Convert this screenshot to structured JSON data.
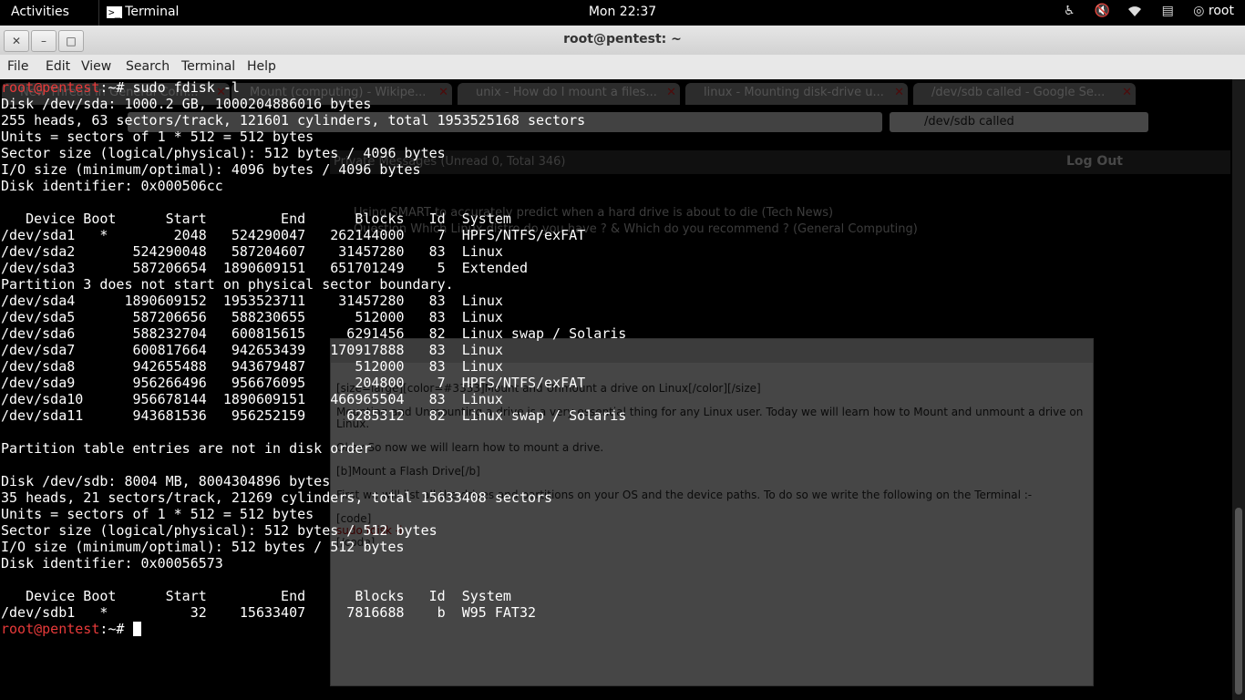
{
  "topbar": {
    "activities": "Activities",
    "app_name": "Terminal",
    "clock": "Mon 22:37",
    "user": "root"
  },
  "window": {
    "title": "root@pentest: ~"
  },
  "menu": [
    "File",
    "Edit",
    "View",
    "Search",
    "Terminal",
    "Help"
  ],
  "terminal": {
    "prompt_user": "root@pentest",
    "prompt_suffix": ":~# ",
    "command": "sudo fdisk -l",
    "output": "Disk /dev/sda: 1000.2 GB, 1000204886016 bytes\n255 heads, 63 sectors/track, 121601 cylinders, total 1953525168 sectors\nUnits = sectors of 1 * 512 = 512 bytes\nSector size (logical/physical): 512 bytes / 4096 bytes\nI/O size (minimum/optimal): 4096 bytes / 4096 bytes\nDisk identifier: 0x000506cc\n\n   Device Boot      Start         End      Blocks   Id  System\n/dev/sda1   *        2048   524290047   262144000    7  HPFS/NTFS/exFAT\n/dev/sda2       524290048   587204607    31457280   83  Linux\n/dev/sda3       587206654  1890609151   651701249    5  Extended\nPartition 3 does not start on physical sector boundary.\n/dev/sda4      1890609152  1953523711    31457280   83  Linux\n/dev/sda5       587206656   588230655      512000   83  Linux\n/dev/sda6       588232704   600815615     6291456   82  Linux swap / Solaris\n/dev/sda7       600817664   942653439   170917888   83  Linux\n/dev/sda8       942655488   943679487      512000   83  Linux\n/dev/sda9       956266496   956676095      204800    7  HPFS/NTFS/exFAT\n/dev/sda10      956678144  1890609151   466965504   83  Linux\n/dev/sda11      943681536   956252159     6285312   82  Linux swap / Solaris\n\nPartition table entries are not in disk order\n\nDisk /dev/sdb: 8004 MB, 8004304896 bytes\n35 heads, 21 sectors/track, 21269 cylinders, total 15633408 sectors\nUnits = sectors of 1 * 512 = 512 bytes\nSector size (logical/physical): 512 bytes / 512 bytes\nI/O size (minimum/optimal): 512 bytes / 512 bytes\nDisk identifier: 0x00056573\n\n   Device Boot      Start         End      Blocks   Id  System\n/dev/sdb1   *          32    15633407     7816688    b  W95 FAT32"
  },
  "background_browser": {
    "tabs": [
      "New Thread in General Com...",
      "Mount (computing) - Wikipe...",
      "unix - How do I mount a files...",
      "linux - Mounting disk-drive u...",
      "/dev/sdb called - Google Se..."
    ],
    "search_value": "/dev/sdb called",
    "pm_text": "Private Messages (Unread 0, Total 346)",
    "logout": "Log Out",
    "news": [
      "Using SMART to accurately predict when a hard drive is about to die (Tech News)",
      "Question Which Linux distro do you have ? & Which do you recommend ? (General Computing)"
    ],
    "editor_lines": [
      "[size=large][color=#3333]Mount and Unmount a drive on Linux[/color][/size]",
      "Mounting and Unmounting a drive is a very essential thing for any Linux user. Today we will learn how to Mount and unmount a drive on Linux.",
      "Okay So now we will learn how to mount a drive.",
      "[b]Mount a Flash Drive[/b]",
      "First we will list all the drives and partitions on your OS and the device paths. To do so we write the following on the Terminal :-",
      "[code]",
      "sudo fdisk -l",
      "[/code]"
    ]
  },
  "colors": {
    "prompt": "#e83a3a",
    "terminal_bg": "#000000",
    "terminal_fg": "#ffffff"
  }
}
